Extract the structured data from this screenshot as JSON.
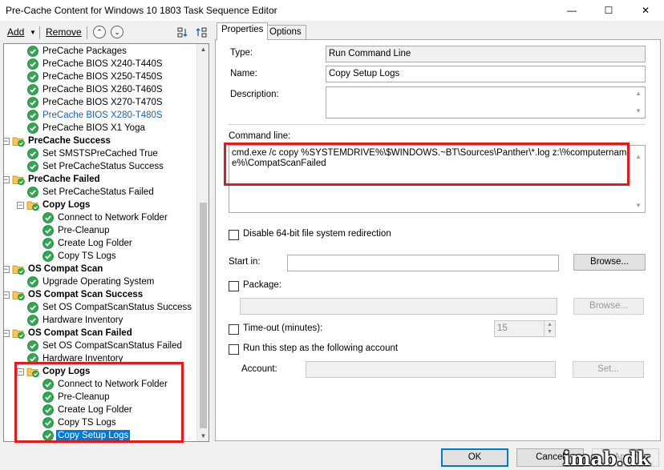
{
  "window": {
    "title": "Pre-Cache Content for Windows 10 1803 Task Sequence Editor",
    "minimize": "—",
    "maximize": "☐",
    "close": "✕"
  },
  "toolbar": {
    "add_label": "Add",
    "remove_label": "Remove"
  },
  "tree": {
    "items": [
      {
        "label": "PreCache Packages",
        "level": 2,
        "type": "step"
      },
      {
        "label": "PreCache BIOS X240-T440S",
        "level": 2,
        "type": "step"
      },
      {
        "label": "PreCache BIOS X250-T450S",
        "level": 2,
        "type": "step"
      },
      {
        "label": "PreCache BIOS X260-T460S",
        "level": 2,
        "type": "step"
      },
      {
        "label": "PreCache BIOS X270-T470S",
        "level": 2,
        "type": "step"
      },
      {
        "label": "PreCache BIOS X280-T480S",
        "level": 2,
        "type": "step",
        "link": true
      },
      {
        "label": "PreCache BIOS X1 Yoga",
        "level": 2,
        "type": "step"
      },
      {
        "label": "PreCache Success",
        "level": 1,
        "type": "group"
      },
      {
        "label": "Set SMSTSPreCached True",
        "level": 2,
        "type": "step"
      },
      {
        "label": "Set PreCacheStatus Success",
        "level": 2,
        "type": "step"
      },
      {
        "label": "PreCache Failed",
        "level": 1,
        "type": "group"
      },
      {
        "label": "Set PreCacheStatus Failed",
        "level": 2,
        "type": "step"
      },
      {
        "label": "Copy Logs",
        "level": 2,
        "type": "group"
      },
      {
        "label": "Connect to Network Folder",
        "level": 3,
        "type": "step"
      },
      {
        "label": "Pre-Cleanup",
        "level": 3,
        "type": "step"
      },
      {
        "label": "Create Log Folder",
        "level": 3,
        "type": "step"
      },
      {
        "label": "Copy TS Logs",
        "level": 3,
        "type": "step"
      },
      {
        "label": "OS Compat Scan",
        "level": 1,
        "type": "group"
      },
      {
        "label": "Upgrade Operating System",
        "level": 2,
        "type": "step"
      },
      {
        "label": "OS Compat Scan Success",
        "level": 1,
        "type": "group"
      },
      {
        "label": "Set OS CompatScanStatus Success",
        "level": 2,
        "type": "step"
      },
      {
        "label": "Hardware Inventory",
        "level": 2,
        "type": "step"
      },
      {
        "label": "OS Compat Scan Failed",
        "level": 1,
        "type": "group"
      },
      {
        "label": "Set OS CompatScanStatus Failed",
        "level": 2,
        "type": "step"
      },
      {
        "label": "Hardware Inventory",
        "level": 2,
        "type": "step"
      },
      {
        "label": "Copy Logs",
        "level": 2,
        "type": "group"
      },
      {
        "label": "Connect to Network Folder",
        "level": 3,
        "type": "step"
      },
      {
        "label": "Pre-Cleanup",
        "level": 3,
        "type": "step"
      },
      {
        "label": "Create Log Folder",
        "level": 3,
        "type": "step"
      },
      {
        "label": "Copy TS Logs",
        "level": 3,
        "type": "step"
      },
      {
        "label": "Copy Setup Logs",
        "level": 3,
        "type": "step",
        "selected": true
      }
    ]
  },
  "tabs": [
    {
      "label": "Properties",
      "active": true
    },
    {
      "label": "Options",
      "active": false
    }
  ],
  "properties": {
    "type_label": "Type:",
    "type_value": "Run Command Line",
    "name_label": "Name:",
    "name_value": "Copy Setup Logs",
    "description_label": "Description:",
    "description_value": "",
    "command_line_label": "Command line:",
    "command_line_value": "cmd.exe /c copy %SYSTEMDRIVE%\\$WINDOWS.~BT\\Sources\\Panther\\*.log z:\\%computername%\\CompatScanFailed",
    "disable64_label": "Disable 64-bit file system redirection",
    "start_in_label": "Start in:",
    "start_in_value": "",
    "browse_label": "Browse...",
    "package_label": "Package:",
    "package_value": "",
    "package_browse_label": "Browse...",
    "timeout_label": "Time-out (minutes):",
    "timeout_value": "15",
    "run_as_label": "Run this step as the following account",
    "account_label": "Account:",
    "account_value": "",
    "set_label": "Set..."
  },
  "footer": {
    "ok_label": "OK",
    "cancel_label": "Cancel",
    "apply_label": "Apply"
  },
  "watermark": "imab.dk",
  "colors": {
    "selection": "#0078d7",
    "highlight_border": "#e5191d",
    "link_text": "#1a5fb4",
    "check_green": "#2fa84f"
  }
}
